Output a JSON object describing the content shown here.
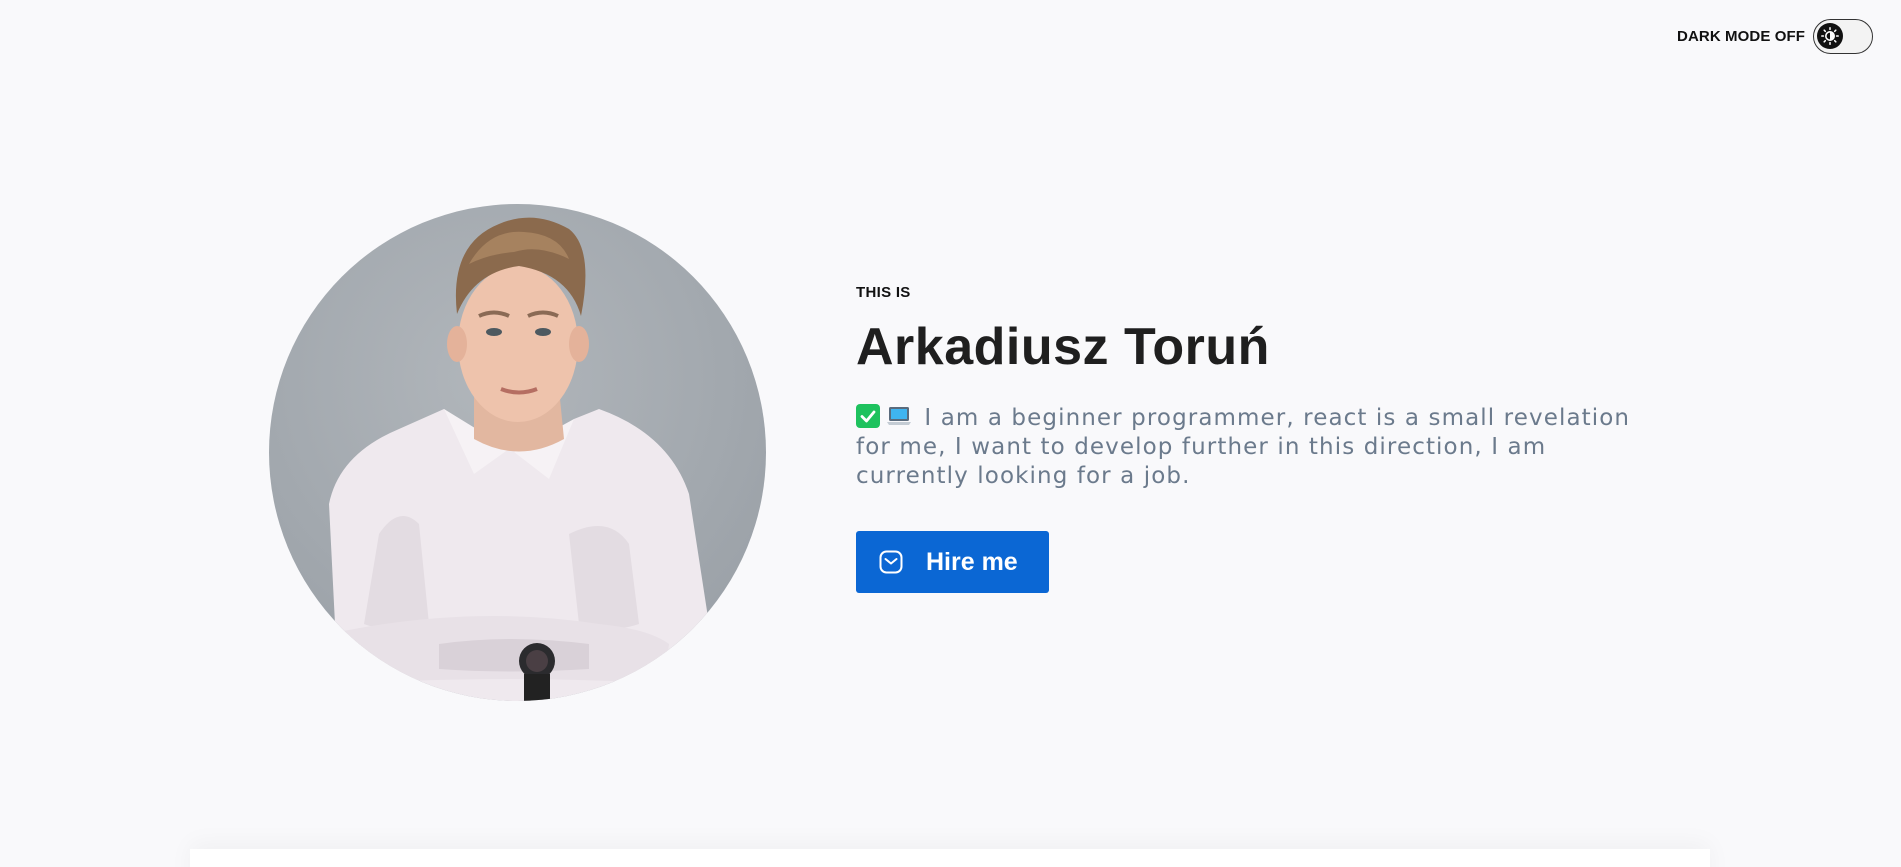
{
  "dark_mode": {
    "label": "DARK MODE OFF",
    "enabled": false,
    "icon": "sun-icon"
  },
  "hero": {
    "kicker": "THIS IS",
    "name": "Arkadiusz Toruń",
    "description_emojis": [
      "check-mark-emoji",
      "laptop-emoji"
    ],
    "description": "I am a beginner programmer, react is a small revelation for me, I want to develop further in this direction, I am currently looking for a job.",
    "cta": {
      "label": "Hire me",
      "icon": "mail-icon"
    }
  },
  "photo": {
    "subject": "portrait"
  },
  "colors": {
    "accent": "#0b67d4",
    "background": "#f9f9fb",
    "text_muted": "#6b7a8c",
    "heading": "#1f1f1f"
  }
}
